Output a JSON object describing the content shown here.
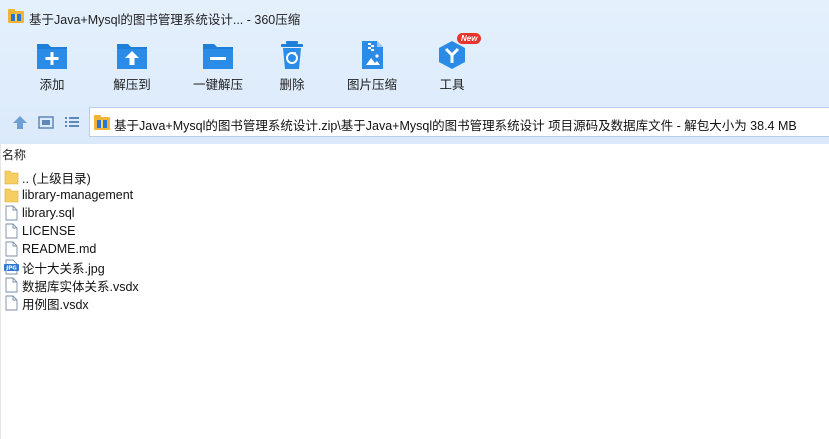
{
  "window": {
    "title": "基于Java+Mysql的图书管理系统设计... - 360压缩"
  },
  "toolbar": {
    "buttons": [
      {
        "label": "添加",
        "icon": "add-icon"
      },
      {
        "label": "解压到",
        "icon": "extract-to-icon"
      },
      {
        "label": "一键解压",
        "icon": "one-click-extract-icon"
      },
      {
        "label": "删除",
        "icon": "delete-icon"
      },
      {
        "label": "图片压缩",
        "icon": "image-compress-icon"
      },
      {
        "label": "工具",
        "icon": "tools-icon",
        "badge": "New"
      }
    ]
  },
  "navigation": {
    "up_icon": "up-arrow-icon",
    "view_icon": "view-thumbnail-icon",
    "list_icon": "view-list-icon",
    "path": "基于Java+Mysql的图书管理系统设计.zip\\基于Java+Mysql的图书管理系统设计 项目源码及数据库文件 - 解包大小为 38.4 MB"
  },
  "file_list": {
    "column_name": "名称",
    "items": [
      {
        "name": ".. (上级目录)",
        "type": "parent-folder"
      },
      {
        "name": "library-management",
        "type": "folder"
      },
      {
        "name": "library.sql",
        "type": "file"
      },
      {
        "name": "LICENSE",
        "type": "file"
      },
      {
        "name": "README.md",
        "type": "file"
      },
      {
        "name": "论十大关系.jpg",
        "type": "image"
      },
      {
        "name": "数据库实体关系.vsdx",
        "type": "file"
      },
      {
        "name": "用例图.vsdx",
        "type": "file"
      }
    ]
  },
  "colors": {
    "chrome_bg": "#dbeafb",
    "icon_blue": "#1f7fd8",
    "badge_red": "#e8352b",
    "folder_yellow": "#f6cf62"
  }
}
